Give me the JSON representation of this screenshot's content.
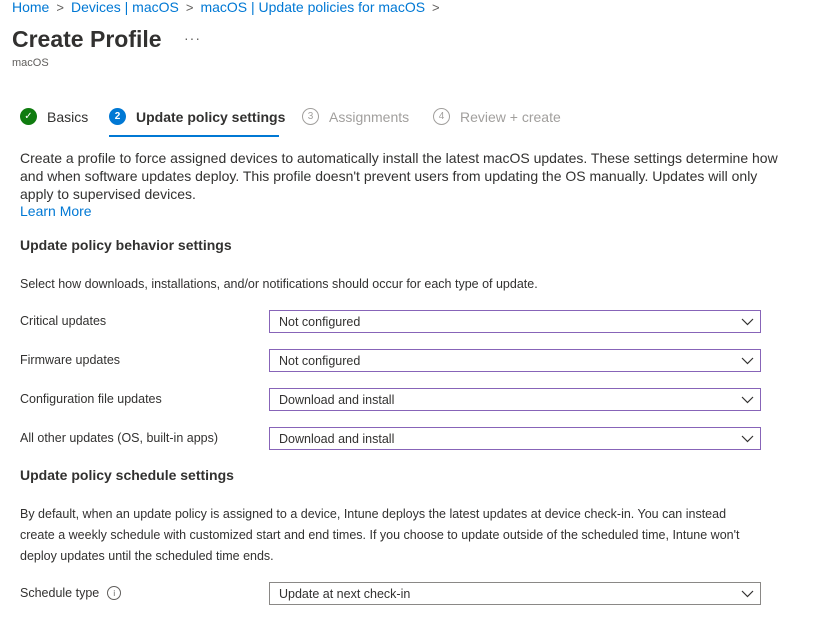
{
  "breadcrumb": {
    "items": [
      "Home",
      "Devices | macOS",
      "macOS | Update policies for macOS"
    ],
    "separator": ">"
  },
  "page": {
    "title": "Create Profile",
    "more_label": "···",
    "subtitle": "macOS"
  },
  "wizard": {
    "steps": [
      {
        "number": "✓",
        "label": "Basics",
        "state": "done"
      },
      {
        "number": "2",
        "label": "Update policy settings",
        "state": "active"
      },
      {
        "number": "3",
        "label": "Assignments",
        "state": "pending"
      },
      {
        "number": "4",
        "label": "Review + create",
        "state": "pending"
      }
    ]
  },
  "intro": {
    "description": "Create a profile to force assigned devices to automatically install the latest macOS updates. These settings determine how and when software updates deploy. This profile doesn't prevent users from updating the OS manually. Updates will only apply to supervised devices.",
    "learn_more": "Learn More"
  },
  "behavior": {
    "heading": "Update policy behavior settings",
    "note": "Select how downloads, installations, and/or notifications should occur for each type of update.",
    "rows": [
      {
        "label": "Critical updates",
        "value": "Not configured"
      },
      {
        "label": "Firmware updates",
        "value": "Not configured"
      },
      {
        "label": "Configuration file updates",
        "value": "Download and install"
      },
      {
        "label": "All other updates (OS, built-in apps)",
        "value": "Download and install"
      }
    ]
  },
  "schedule": {
    "heading": "Update policy schedule settings",
    "paragraph": "By default, when an update policy is assigned to a device, Intune deploys the latest updates at device check-in. You can instead create a weekly schedule with customized start and end times. If you choose to update outside of the scheduled time, Intune won't deploy updates until the scheduled time ends.",
    "type_label": "Schedule type",
    "info_icon": "i",
    "type_value": "Update at next check-in"
  },
  "colors": {
    "link": "#0078d4",
    "done": "#107c10",
    "active": "#0078d4",
    "dropdown_border": "#8764b8"
  }
}
